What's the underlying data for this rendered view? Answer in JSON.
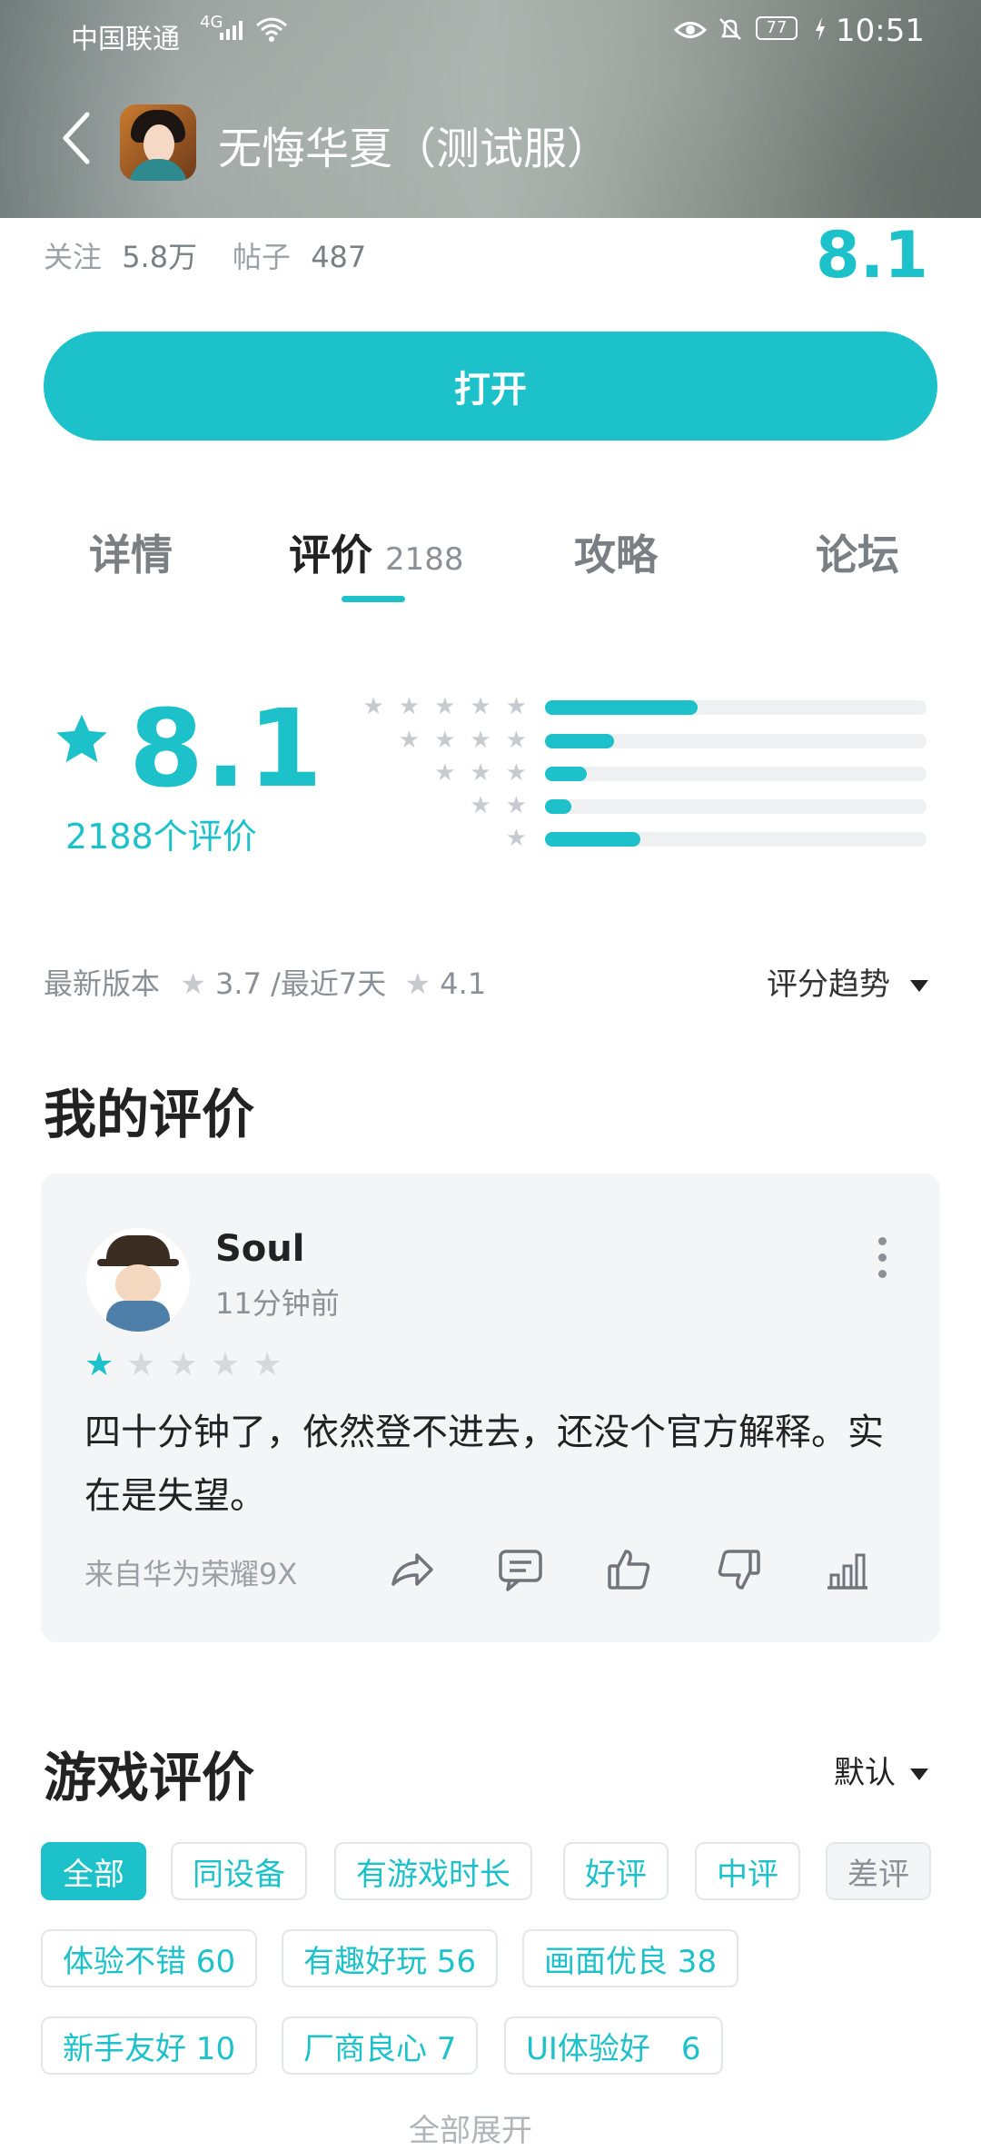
{
  "status_bar": {
    "carrier": "中国联通",
    "network": "4G",
    "battery": "77",
    "time": "10:51"
  },
  "header": {
    "title": "无悔华夏（测试服）"
  },
  "meta": {
    "follow_label": "关注",
    "follow_value": "5.8万",
    "posts_label": "帖子",
    "posts_value": "487",
    "score": "8.1"
  },
  "open_button": "打开",
  "tabs": [
    {
      "label": "详情"
    },
    {
      "label": "评价",
      "count": "2188"
    },
    {
      "label": "攻略"
    },
    {
      "label": "论坛"
    }
  ],
  "rating": {
    "value": "8.1",
    "count_text": "2188个评价",
    "distribution": [
      {
        "stars": 5,
        "fraction": 0.4
      },
      {
        "stars": 4,
        "fraction": 0.18
      },
      {
        "stars": 3,
        "fraction": 0.11
      },
      {
        "stars": 2,
        "fraction": 0.07
      },
      {
        "stars": 1,
        "fraction": 0.25
      }
    ]
  },
  "version_line": {
    "latest_label": "最新版本",
    "latest_value": "3.7",
    "recent_label": "/最近7天",
    "recent_value": "4.1",
    "trend_label": "评分趋势"
  },
  "my_review": {
    "section_title": "我的评价",
    "username": "Soul",
    "time": "11分钟前",
    "stars": 1,
    "text": "四十分钟了，依然登不进去，还没个官方解释。实在是失望。",
    "device": "来自华为荣耀9X",
    "icons": [
      "share-icon",
      "comment-icon",
      "like-icon",
      "dislike-icon",
      "stats-icon"
    ]
  },
  "game_reviews": {
    "section_title": "游戏评价",
    "sort_label": "默认",
    "filters_row1": [
      "全部",
      "同设备",
      "有游戏时长",
      "好评",
      "中评",
      "差评"
    ],
    "filters_row2": [
      "体验不错 60",
      "有趣好玩 56",
      "画面优良 38"
    ],
    "filters_row3": [
      "新手友好 10",
      "厂商良心 7",
      "UI体验好　6"
    ],
    "expand_label": "全部展开"
  },
  "colors": {
    "accent": "#1cc1c9",
    "muted": "#8a9096"
  }
}
